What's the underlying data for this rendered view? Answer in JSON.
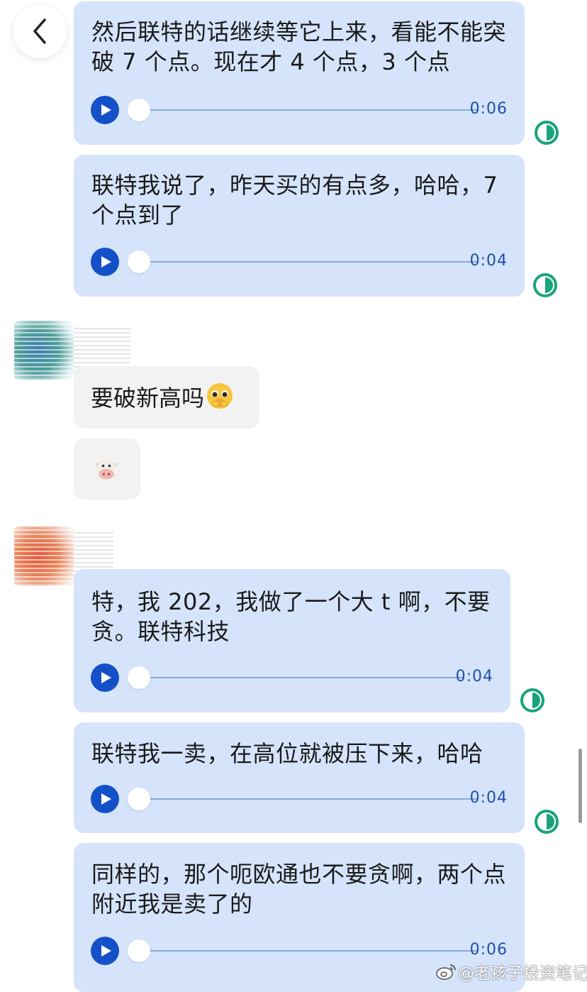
{
  "icons": {
    "back": "chevron-left-icon",
    "play": "play-icon",
    "status": "half-circle-status-icon",
    "weibo": "weibo-logo-icon",
    "emoji_pleading": "pleading-face-emoji",
    "emoji_cow": "cow-face-emoji"
  },
  "colors": {
    "bubble_blue": "#d5e4fb",
    "play_blue": "#1450c8",
    "status_green": "#1aa37a",
    "grey_bubble": "#f2f2f2"
  },
  "messages": [
    {
      "text": "然后联特的话继续等它上来，看能不能突破 7 个点。现在才 4 个点，3 个点",
      "duration": "0:06"
    },
    {
      "text": "联特我说了，昨天买的有点多，哈哈，7 个点到了",
      "duration": "0:04"
    },
    {
      "text": "要破新高吗"
    },
    {
      "text": "🐮"
    },
    {
      "text": "特，我 202，我做了一个大 t 啊，不要贪。联特科技",
      "duration": "0:04"
    },
    {
      "text": "联特我一卖，在高位就被压下来，哈哈",
      "duration": "0:04"
    },
    {
      "text": "同样的，那个呃欧通也不要贪啊，两个点附近我是卖了的",
      "duration": "0:06"
    }
  ],
  "watermark": "@老孩子投资笔记"
}
